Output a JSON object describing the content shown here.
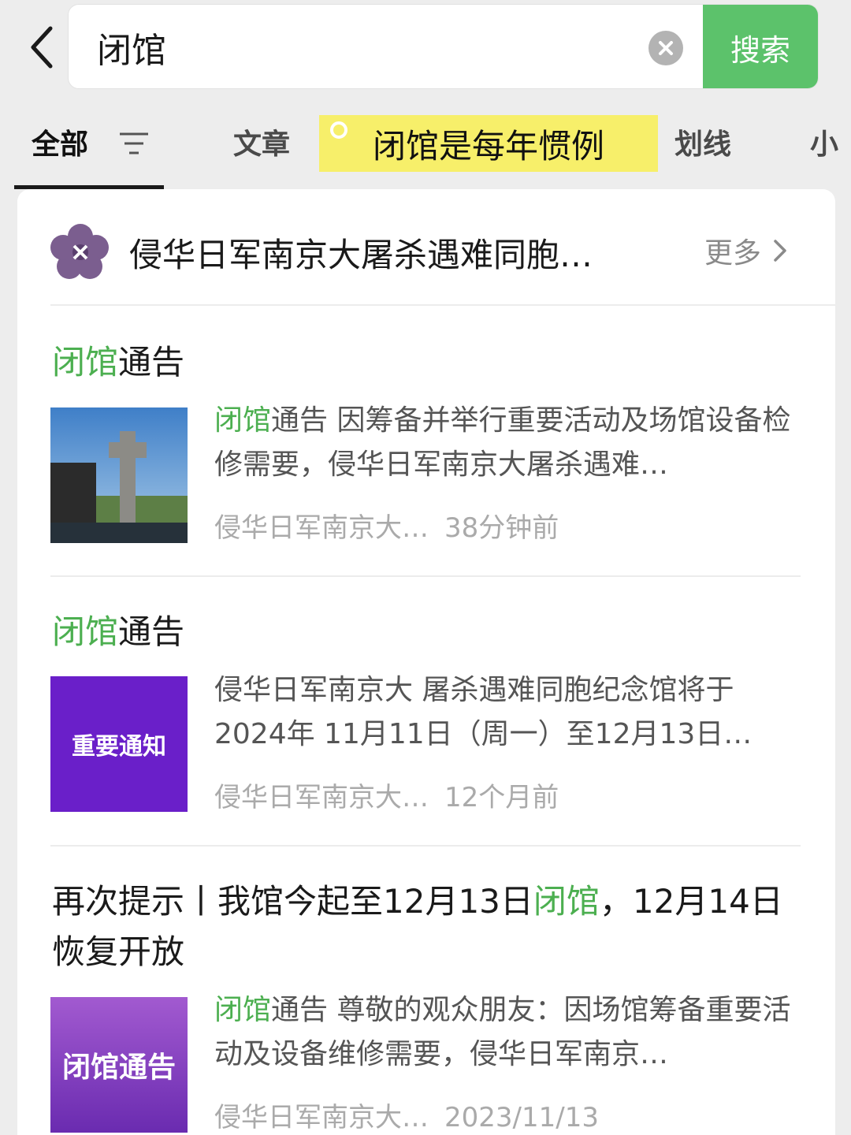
{
  "search": {
    "query": "闭馆",
    "button_label": "搜索"
  },
  "tabs": {
    "items": [
      {
        "label": "全部"
      },
      {
        "label": "文章"
      },
      {
        "label": "划线"
      },
      {
        "label": "小"
      }
    ],
    "sticky_note": "闭馆是每年惯例"
  },
  "account": {
    "name": "侵华日军南京大屠杀遇难同胞…",
    "more_label": "更多"
  },
  "articles": [
    {
      "title_highlight": "闭馆",
      "title_rest": "通告",
      "snippet_highlight": "闭馆",
      "snippet_rest": "通告 因筹备并举行重要活动及场馆设备检修需要，侵华日军南京大屠杀遇难…",
      "source": "侵华日军南京大…",
      "time": "38分钟前"
    },
    {
      "title_highlight": "闭馆",
      "title_rest": "通告",
      "thumb_text": "重要通知",
      "snippet": "侵华日军南京大 屠杀遇难同胞纪念馆将于2024年 11月11日（周一）至12月13日…",
      "source": "侵华日军南京大…",
      "time": "12个月前"
    },
    {
      "title_before": "再次提示丨我馆今起至12月13日",
      "title_highlight": "闭馆",
      "title_after": "，12月14日恢复开放",
      "thumb_text": "闭馆通告",
      "snippet_highlight": "闭馆",
      "snippet_rest": "通告 尊敬的观众朋友：因场馆筹备重要活动及设备维修需要，侵华日军南京…",
      "source": "侵华日军南京大…",
      "time": "2023/11/13"
    }
  ],
  "colors": {
    "accent_green": "#5cc26b",
    "highlight_green": "#4caf50",
    "notice_purple": "#6a1fc9",
    "closure_purple": "#8a3bbf"
  }
}
